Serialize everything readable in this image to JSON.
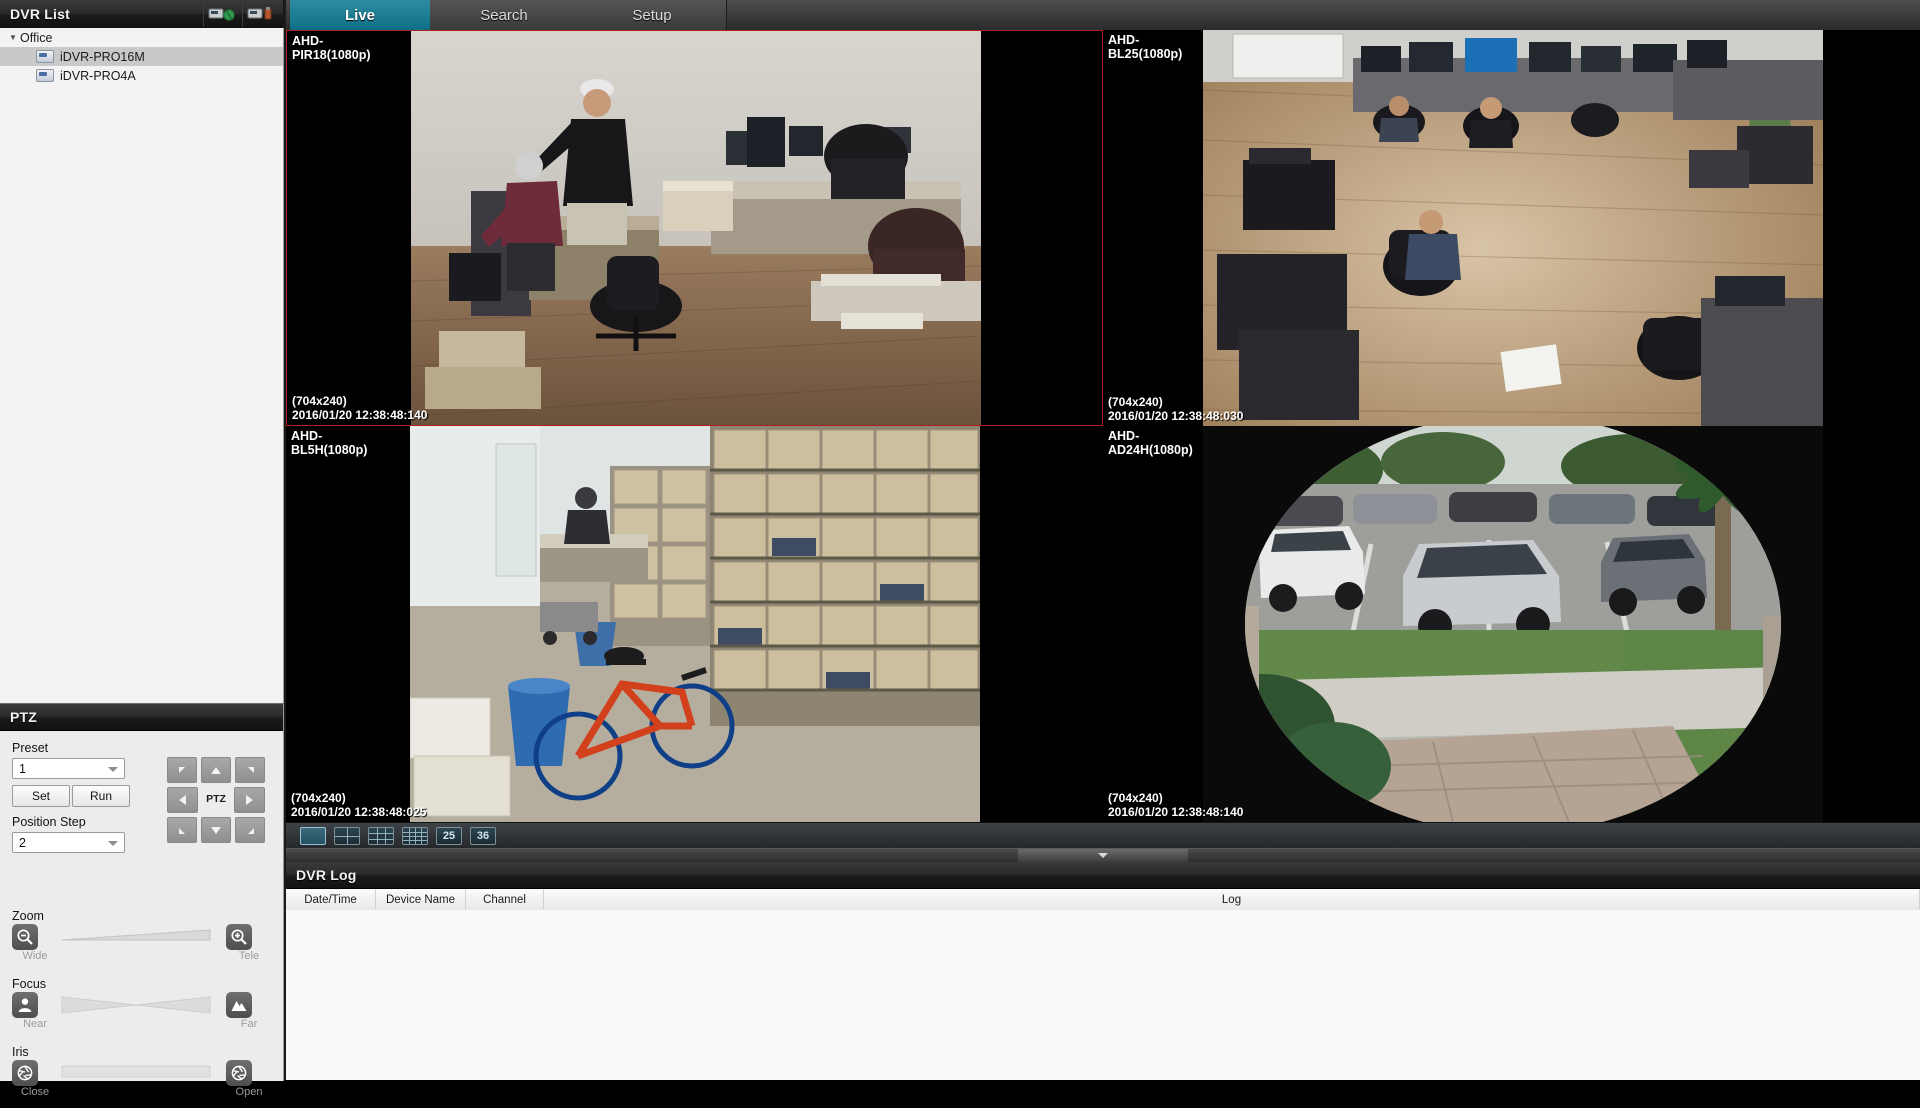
{
  "window": {
    "dvr_list_title": "DVR List",
    "header_icons": [
      {
        "name": "connect-dvr-icon",
        "label": "connect"
      },
      {
        "name": "disconnect-dvr-icon",
        "label": "disconnect"
      }
    ]
  },
  "tree": {
    "group": "Office",
    "items": [
      {
        "label": "iDVR-PRO16M",
        "selected": true
      },
      {
        "label": "iDVR-PRO4A",
        "selected": false
      }
    ]
  },
  "tabs": [
    {
      "label": "Live",
      "active": true
    },
    {
      "label": "Search",
      "active": false
    },
    {
      "label": "Setup",
      "active": false
    }
  ],
  "ptz": {
    "title": "PTZ",
    "preset_label": "Preset",
    "preset_value": "1",
    "set_label": "Set",
    "run_label": "Run",
    "position_step_label": "Position Step",
    "position_step_value": "2",
    "pad_center_label": "PTZ",
    "zoom": {
      "title": "Zoom",
      "min_label": "Wide",
      "max_label": "Tele"
    },
    "focus": {
      "title": "Focus",
      "min_label": "Near",
      "max_label": "Far"
    },
    "iris": {
      "title": "Iris",
      "min_label": "Close",
      "max_label": "Open"
    }
  },
  "cameras": [
    {
      "name": "AHD-PIR18(1080p)",
      "line1": "AHD-",
      "line2": "PIR18(1080p)",
      "resolution": "(704x240)",
      "timestamp": "2016/01/20 12:38:48:140",
      "active": true,
      "scene": "office-interior"
    },
    {
      "name": "AHD-BL25(1080p)",
      "line1": "AHD-",
      "line2": "BL25(1080p)",
      "resolution": "(704x240)",
      "timestamp": "2016/01/20 12:38:48:030",
      "active": false,
      "scene": "office-overhead"
    },
    {
      "name": "AHD-BL5H(1080p)",
      "line1": "AHD-",
      "line2": "BL5H(1080p)",
      "resolution": "(704x240)",
      "timestamp": "2016/01/20 12:38:48:025",
      "active": false,
      "scene": "warehouse"
    },
    {
      "name": "AHD-AD24H(1080p)",
      "line1": "AHD-",
      "line2": "AD24H(1080p)",
      "resolution": "(704x240)",
      "timestamp": "2016/01/20 12:38:48:140",
      "active": false,
      "scene": "parking-lot-fisheye"
    }
  ],
  "layout_buttons": [
    {
      "name": "layout-1",
      "type": "grid",
      "cols": 1,
      "rows": 1,
      "label": "",
      "selected": true
    },
    {
      "name": "layout-4",
      "type": "grid",
      "cols": 2,
      "rows": 2,
      "label": "",
      "selected": false
    },
    {
      "name": "layout-9",
      "type": "grid",
      "cols": 3,
      "rows": 3,
      "label": "",
      "selected": false
    },
    {
      "name": "layout-16",
      "type": "grid",
      "cols": 4,
      "rows": 4,
      "label": "",
      "selected": false
    },
    {
      "name": "layout-25",
      "type": "number",
      "cols": 0,
      "rows": 0,
      "label": "25",
      "selected": false
    },
    {
      "name": "layout-36",
      "type": "number",
      "cols": 0,
      "rows": 0,
      "label": "36",
      "selected": false
    }
  ],
  "log": {
    "title": "DVR Log",
    "columns": [
      "Date/Time",
      "Device Name",
      "Channel",
      "Log"
    ],
    "rows": []
  },
  "colors": {
    "accent": "#0d6f86",
    "active_cell_border": "#b02020",
    "panel_bg": "#ececec",
    "chrome_dark": "#2b2b2b"
  }
}
